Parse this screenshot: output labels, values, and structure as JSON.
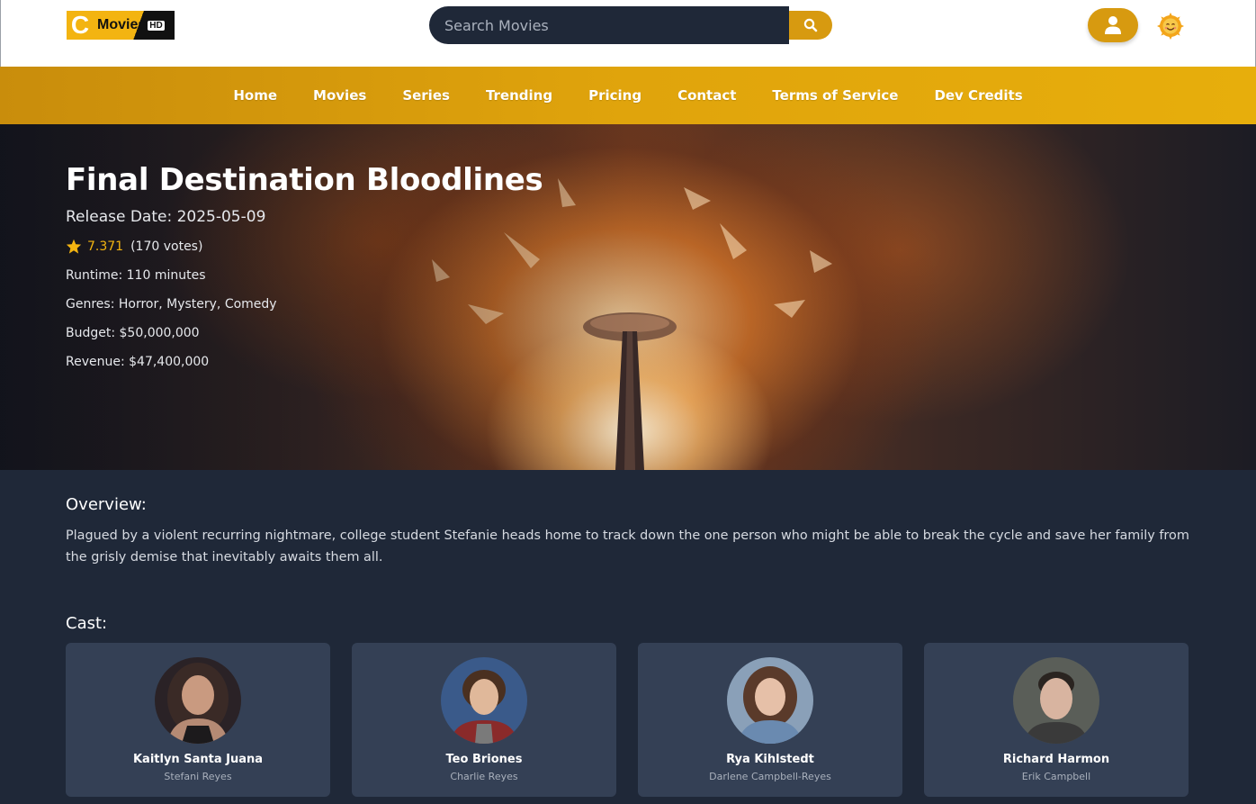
{
  "brand": {
    "name": "Movies",
    "badge": "HD",
    "letter": "C",
    "colors": {
      "accent": "#d79a10",
      "brand_yellow": "#f3b411",
      "page_bg": "#1f2838",
      "card_bg": "#344055"
    }
  },
  "search": {
    "placeholder": "Search Movies",
    "value": ""
  },
  "header": {
    "user_icon": "user-icon",
    "theme_icon": "sun-face-icon"
  },
  "nav": {
    "items": [
      {
        "label": "Home"
      },
      {
        "label": "Movies"
      },
      {
        "label": "Series"
      },
      {
        "label": "Trending"
      },
      {
        "label": "Pricing"
      },
      {
        "label": "Contact"
      },
      {
        "label": "Terms of Service"
      },
      {
        "label": "Dev Credits"
      }
    ]
  },
  "movie": {
    "title": "Final Destination Bloodlines",
    "release_date": "Release Date: 2025-05-09",
    "rating": "7.371",
    "votes": "(170 votes)",
    "runtime": "Runtime: 110 minutes",
    "genres": "Genres: Horror, Mystery, Comedy",
    "budget": "Budget: $50,000,000",
    "revenue": "Revenue: $47,400,000"
  },
  "overview": {
    "heading": "Overview:",
    "text": "Plagued by a violent recurring nightmare, college student Stefanie heads home to track down the one person who might be able to break the cycle and save her family from the grisly demise that inevitably awaits them all."
  },
  "cast": {
    "heading": "Cast:",
    "members": [
      {
        "name": "Kaitlyn Santa Juana",
        "character": "Stefani Reyes"
      },
      {
        "name": "Teo Briones",
        "character": "Charlie Reyes"
      },
      {
        "name": "Rya Kihlstedt",
        "character": "Darlene Campbell-Reyes"
      },
      {
        "name": "Richard Harmon",
        "character": "Erik Campbell"
      }
    ]
  }
}
